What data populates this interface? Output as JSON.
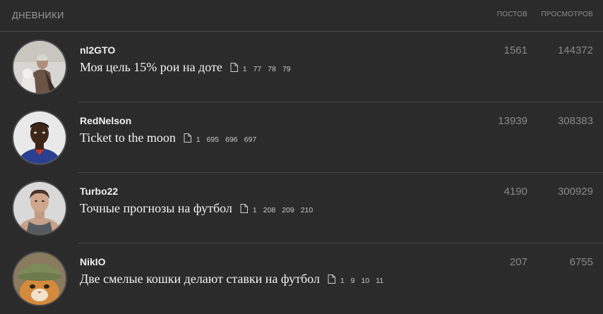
{
  "header": {
    "title": "ДНЕВНИКИ",
    "col_posts": "ПОСТОВ",
    "col_views": "ПРОСМОТРОВ"
  },
  "icons": {
    "doc": "document-icon"
  },
  "colors": {
    "background": "#2b2b2b",
    "text": "#f2f2f2",
    "muted": "#8a8a8a"
  },
  "blogs": [
    {
      "user": "nl2GTO",
      "title": "Моя цель 15% рои на доте",
      "pages": [
        "1",
        "77",
        "78",
        "79"
      ],
      "posts": "1561",
      "views": "144372"
    },
    {
      "user": "RedNelson",
      "title": "Ticket to the moon",
      "pages": [
        "1",
        "695",
        "696",
        "697"
      ],
      "posts": "13939",
      "views": "308383"
    },
    {
      "user": "Turbo22",
      "title": "Точные прогнозы на футбол",
      "pages": [
        "1",
        "208",
        "209",
        "210"
      ],
      "posts": "4190",
      "views": "300929"
    },
    {
      "user": "NikIO",
      "title": "Две смелые кошки делают ставки на футбол",
      "pages": [
        "1",
        "9",
        "10",
        "11"
      ],
      "posts": "207",
      "views": "6755"
    }
  ]
}
